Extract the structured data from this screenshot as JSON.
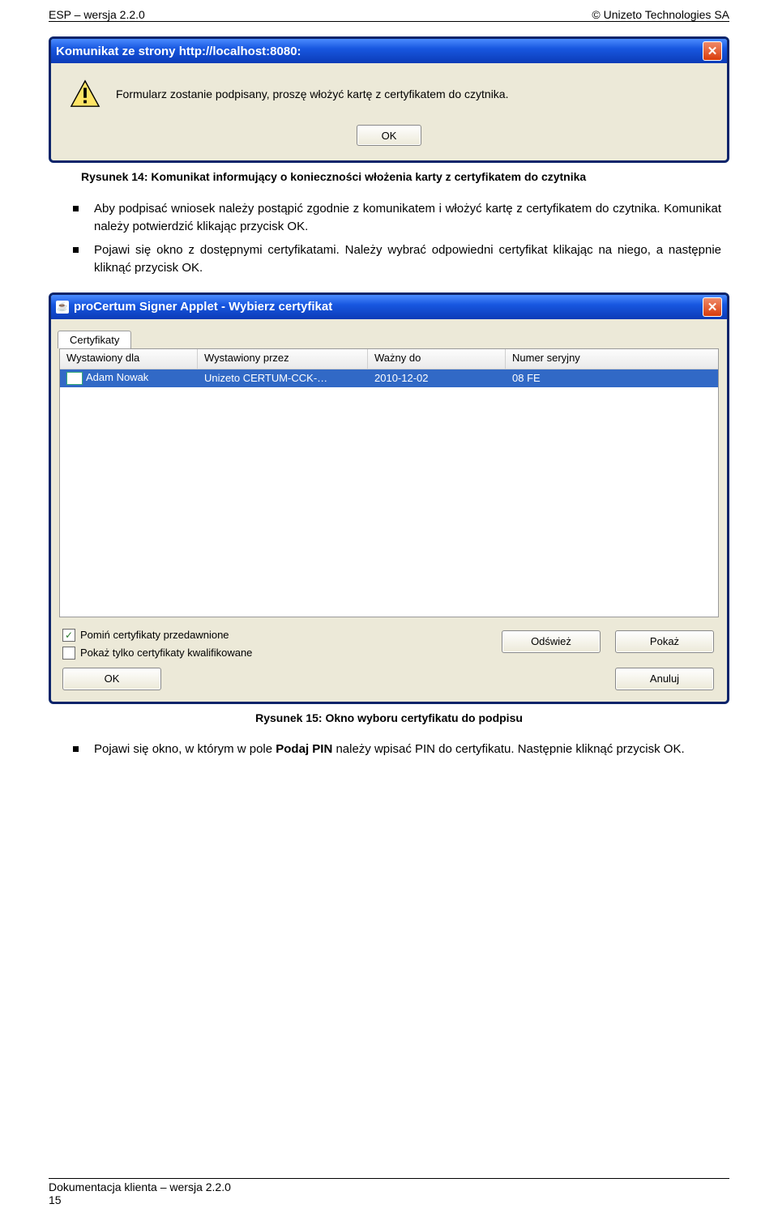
{
  "header": {
    "left": "ESP – wersja 2.2.0",
    "right": "© Unizeto Technologies SA"
  },
  "dialog1": {
    "title": "Komunikat ze strony http://localhost:8080:",
    "message": "Formularz zostanie podpisany, proszę włożyć kartę z certyfikatem do czytnika.",
    "ok": "OK"
  },
  "caption1": "Rysunek 14: Komunikat informujący o konieczności włożenia karty z certyfikatem do czytnika",
  "bullets1": {
    "b1": "Aby podpisać wniosek należy postąpić zgodnie z komunikatem i włożyć kartę z certyfikatem do czytnika. Komunikat należy potwierdzić klikając przycisk OK.",
    "b2": "Pojawi się okno z dostępnymi certyfikatami. Należy wybrać odpowiedni certyfikat klikając na niego, a następnie kliknąć przycisk OK."
  },
  "dialog2": {
    "title": "proCertum Signer Applet - Wybierz certyfikat",
    "tab": "Certyfikaty",
    "columns": {
      "c1": "Wystawiony dla",
      "c2": "Wystawiony przez",
      "c3": "Ważny do",
      "c4": "Numer seryjny"
    },
    "row": {
      "c1": "Adam Nowak",
      "c2": "Unizeto CERTUM-CCK-…",
      "c3": "2010-12-02",
      "c4": "08 FE"
    },
    "chk1": "Pomiń certyfikaty przedawnione",
    "chk2": "Pokaż tylko certyfikaty kwalifikowane",
    "refresh": "Odśwież",
    "show": "Pokaż",
    "ok": "OK",
    "cancel": "Anuluj"
  },
  "caption2": "Rysunek 15: Okno wyboru certyfikatu do podpisu",
  "bullets2": {
    "b1_pre": "Pojawi się okno, w którym w pole ",
    "b1_bold": "Podaj PIN",
    "b1_post": " należy wpisać PIN do certyfikatu. Następnie kliknąć przycisk OK."
  },
  "footer": {
    "l1": "Dokumentacja klienta  – wersja 2.2.0",
    "l2": "15"
  }
}
